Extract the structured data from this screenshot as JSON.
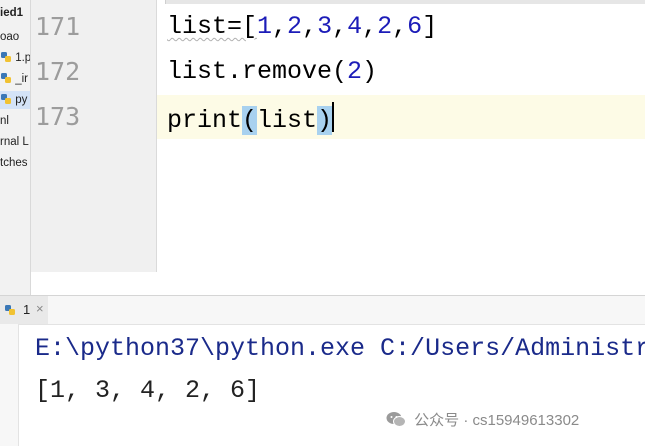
{
  "sidebar": {
    "items": [
      {
        "label": "ied1",
        "icon": "folder-icon"
      },
      {
        "label": "oao",
        "icon": ""
      },
      {
        "label": "1.p",
        "icon": "python-file-icon"
      },
      {
        "label": "_ir",
        "icon": "python-file-icon"
      },
      {
        "label": "py",
        "icon": "python-file-icon",
        "selected": true
      },
      {
        "label": "nl",
        "icon": ""
      },
      {
        "label": "rnal L",
        "icon": ""
      },
      {
        "label": "tches",
        "icon": ""
      }
    ]
  },
  "editor": {
    "lines": [
      {
        "number": "171",
        "parts": [
          "list=[",
          "1",
          ",",
          "2",
          ",",
          "3",
          ",",
          "4",
          ",",
          "2",
          ",",
          "6",
          "]"
        ]
      },
      {
        "number": "172",
        "parts": [
          "list.remove(",
          "2",
          ")"
        ]
      },
      {
        "number": "173",
        "parts": [
          "print",
          "(",
          "list",
          ")"
        ]
      }
    ]
  },
  "run_panel": {
    "tab_label": "1",
    "close_glyph": "×",
    "console": {
      "command": "E:\\python37\\python.exe C:/Users/Administr",
      "output": "[1, 3, 4, 2, 6]"
    }
  },
  "watermark": {
    "text": "公众号 · cs15949613302"
  },
  "colors": {
    "number_blue": "#1c1cb8",
    "bracket_highlight": "#a8d1ef",
    "current_line": "#fdfbe6",
    "console_path": "#1a2a8a"
  }
}
